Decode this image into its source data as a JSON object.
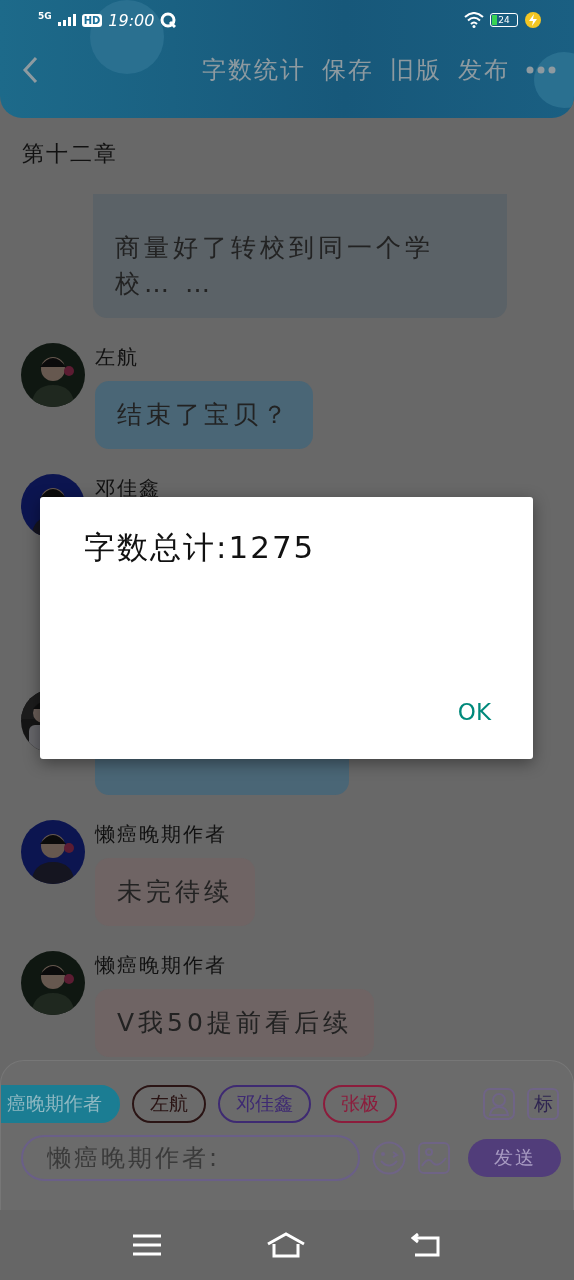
{
  "status_bar": {
    "network": "5G",
    "hd": "HD",
    "time": "19:00",
    "battery": "24"
  },
  "header": {
    "actions": [
      "字数统计",
      "保存",
      "旧版",
      "发布"
    ]
  },
  "chapter_title": "第十二章",
  "messages": [
    {
      "kind": "continued",
      "text": "商量好了转校到同一个学校… …",
      "color": "#5b6267"
    },
    {
      "kind": "text",
      "speaker": "左航",
      "text": "结束了宝贝？",
      "color": "#4a6676"
    },
    {
      "kind": "hidden",
      "speaker": "邓佳鑫"
    },
    {
      "kind": "hidden",
      "color": "#4a6676"
    },
    {
      "kind": "text",
      "speaker": "懒癌晚期作者",
      "text": "未完待续",
      "color": "#6f6464"
    },
    {
      "kind": "text",
      "speaker": "懒癌晚期作者",
      "text": "V我50提前看后续",
      "color": "#6f6464"
    }
  ],
  "composer": {
    "speakers": [
      {
        "label": "癌晚期作者",
        "selected": true,
        "color": "#1b7d93"
      },
      {
        "label": "左航",
        "selected": false,
        "color": "#2a1414"
      },
      {
        "label": "邓佳鑫",
        "selected": false,
        "color": "#3e2a72"
      },
      {
        "label": "张极",
        "selected": false,
        "color": "#8c1c3c"
      }
    ],
    "tag_button": "标",
    "placeholder": "懒癌晚期作者:",
    "send": "发送"
  },
  "dialog": {
    "message": "字数总计:1275",
    "button": "OK"
  }
}
